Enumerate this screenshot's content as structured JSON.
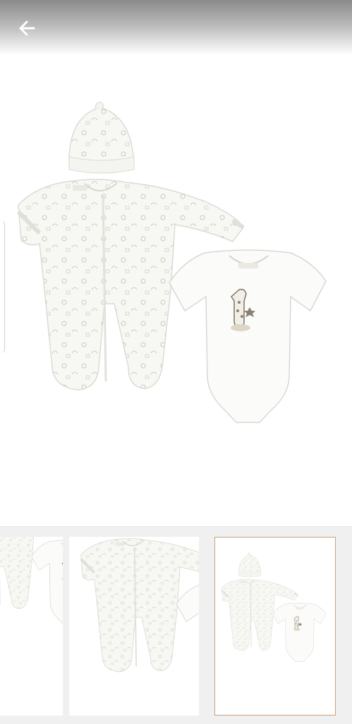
{
  "header": {
    "back_icon": "arrow-left-icon"
  },
  "product": {
    "items": [
      "hat",
      "footed-sleepsuit",
      "short-sleeve-bodysuit"
    ],
    "main_image_index": 3
  },
  "gallery": {
    "thumbnails": [
      {
        "view": "bodysuit-closeup"
      },
      {
        "view": "sleepsuit-closeup"
      },
      {
        "view": "full-set",
        "selected": true
      }
    ],
    "selected_border_color": "#c8a17a"
  },
  "colors": {
    "garment": "#f7f7f4",
    "print": "#c9c2b3",
    "strip": "#f0f0f0"
  }
}
